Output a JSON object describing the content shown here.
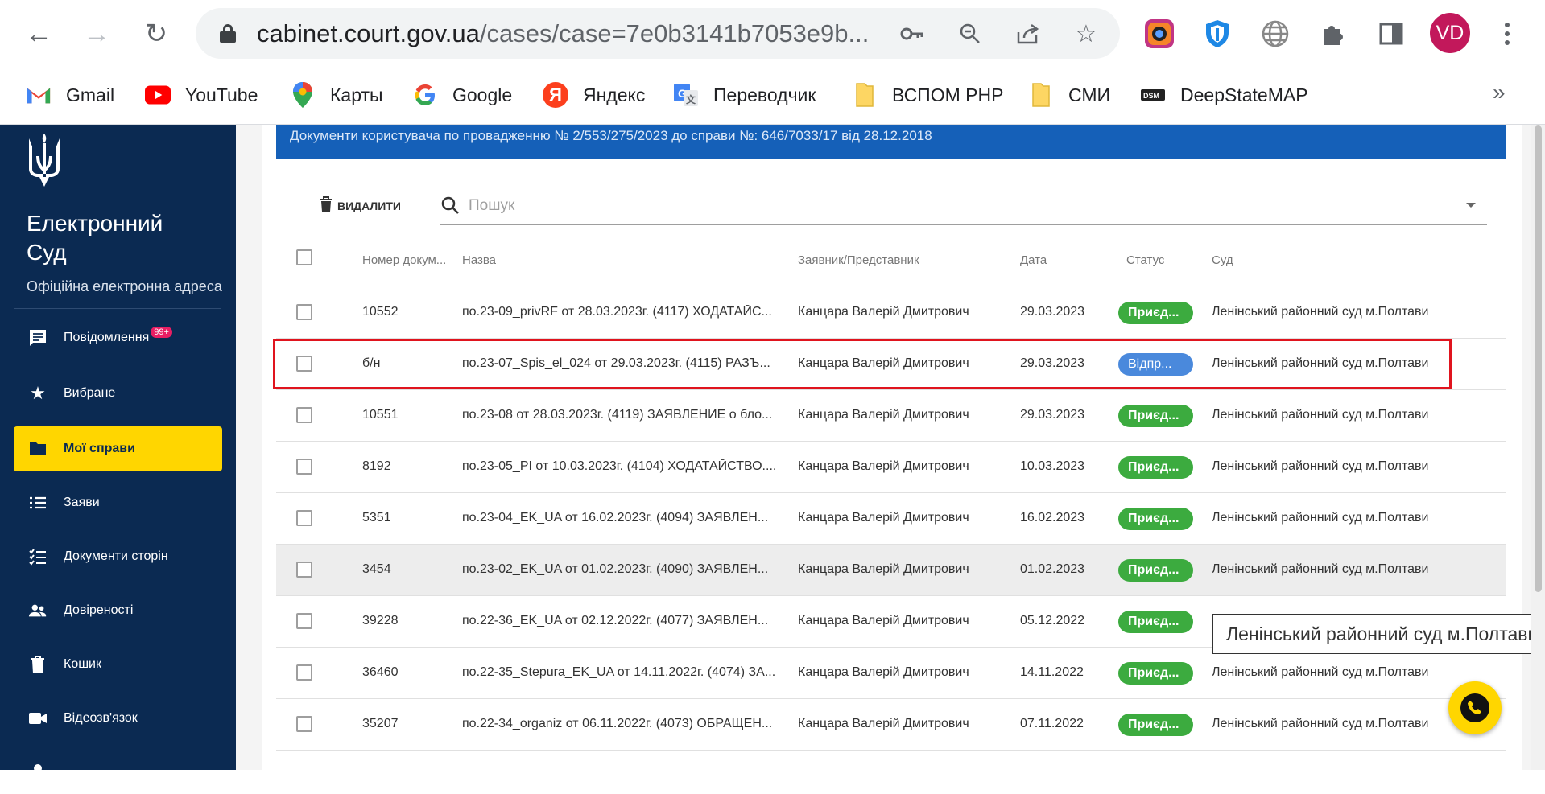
{
  "browser": {
    "url_host": "cabinet.court.gov.ua",
    "url_path": "/cases/case=7e0b3141b7053e9b...",
    "avatar_initials": "VD",
    "bookmarks": [
      {
        "label": "Gmail",
        "icon": "gmail-icon",
        "color": "#ea4335"
      },
      {
        "label": "YouTube",
        "icon": "youtube-icon",
        "color": "#ff0000"
      },
      {
        "label": "Карты",
        "icon": "maps-pin-icon",
        "color": "#34a853"
      },
      {
        "label": "Google",
        "icon": "google-g-icon",
        "color": "#4285f4"
      },
      {
        "label": "Яндекс",
        "icon": "yandex-icon",
        "color": "#fc3f1d"
      },
      {
        "label": "Переводчик",
        "icon": "translate-icon",
        "color": "#4285f4"
      },
      {
        "label": "ВСПОМ PHP",
        "icon": "folder-icon",
        "color": "#fdd663"
      },
      {
        "label": "СМИ",
        "icon": "folder-icon",
        "color": "#fdd663"
      },
      {
        "label": "DeepStateMAP",
        "icon": "deepstate-icon",
        "color": "#222222"
      }
    ]
  },
  "sidebar": {
    "brand_line1": "Електронний",
    "brand_line2": "Суд",
    "brand_sub": "Офіційна електронна адреса",
    "notifications_badge": "99+",
    "items": [
      {
        "label": "Повідомлення",
        "icon": "message-icon"
      },
      {
        "label": "Вибране",
        "icon": "star-icon"
      },
      {
        "label": "Мої справи",
        "icon": "folder-icon",
        "active": true
      },
      {
        "label": "Заяви",
        "icon": "list-icon"
      },
      {
        "label": "Документи сторін",
        "icon": "checklist-icon"
      },
      {
        "label": "Довіреності",
        "icon": "people-icon"
      },
      {
        "label": "Кошик",
        "icon": "trash-icon"
      },
      {
        "label": "Відеозв'язок",
        "icon": "video-icon"
      }
    ]
  },
  "main": {
    "title": "Документи користувача по провадженню № 2/553/275/2023 до справи №: 646/7033/17 від 28.12.2018",
    "delete_label": "ВИДАЛИТИ",
    "search_placeholder": "Пошук",
    "columns": {
      "number": "Номер докум...",
      "name": "Назва",
      "applicant": "Заявник/Представник",
      "date": "Дата",
      "status": "Статус",
      "court": "Суд"
    },
    "rows": [
      {
        "number": "10552",
        "name": "по.23-09_privRF от 28.03.2023г. (4117) ХОДАТАЙС...",
        "applicant": "Канцара Валерій Дмитрович",
        "date": "29.03.2023",
        "status": "Приєд...",
        "status_color": "#3cab3f",
        "court": "Ленінський районний суд м.Полтави"
      },
      {
        "number": "б/н",
        "name": "по.23-07_Spis_el_024 от 29.03.2023г. (4115) РАЗЪ...",
        "applicant": "Канцара Валерій Дмитрович",
        "date": "29.03.2023",
        "status": "Відпр...",
        "status_color": "#4a89dc",
        "court": "Ленінський районний суд м.Полтави"
      },
      {
        "number": "10551",
        "name": "по.23-08 от 28.03.2023г. (4119) ЗАЯВЛЕНИЕ о бло...",
        "applicant": "Канцара Валерій Дмитрович",
        "date": "29.03.2023",
        "status": "Приєд...",
        "status_color": "#3cab3f",
        "court": "Ленінський районний суд м.Полтави"
      },
      {
        "number": "8192",
        "name": "по.23-05_PI от 10.03.2023г. (4104) ХОДАТАЙСТВО....",
        "applicant": "Канцара Валерій Дмитрович",
        "date": "10.03.2023",
        "status": "Приєд...",
        "status_color": "#3cab3f",
        "court": "Ленінський районний суд м.Полтави"
      },
      {
        "number": "5351",
        "name": "по.23-04_EK_UA от 16.02.2023г. (4094) ЗАЯВЛЕН...",
        "applicant": "Канцара Валерій Дмитрович",
        "date": "16.02.2023",
        "status": "Приєд...",
        "status_color": "#3cab3f",
        "court": "Ленінський районний суд м.Полтави"
      },
      {
        "number": "3454",
        "name": "по.23-02_EK_UA от 01.02.2023г. (4090) ЗАЯВЛЕН...",
        "applicant": "Канцара Валерій Дмитрович",
        "date": "01.02.2023",
        "status": "Приєд...",
        "status_color": "#3cab3f",
        "court": "Ленінський районний суд м.Полтави"
      },
      {
        "number": "39228",
        "name": "по.22-36_EK_UA от 02.12.2022г. (4077) ЗАЯВЛЕН...",
        "applicant": "Канцара Валерій Дмитрович",
        "date": "05.12.2022",
        "status": "Приєд...",
        "status_color": "#3cab3f",
        "court": ""
      },
      {
        "number": "36460",
        "name": "по.22-35_Stepura_EK_UA от 14.11.2022г. (4074) ЗА...",
        "applicant": "Канцара Валерій Дмитрович",
        "date": "14.11.2022",
        "status": "Приєд...",
        "status_color": "#3cab3f",
        "court": "Ленінський районний суд м.Полтави"
      },
      {
        "number": "35207",
        "name": "по.22-34_organiz от 06.11.2022г. (4073) ОБРАЩЕН...",
        "applicant": "Канцара Валерій Дмитрович",
        "date": "07.11.2022",
        "status": "Приєд...",
        "status_color": "#3cab3f",
        "court": "Ленінський районний суд м.Полтави"
      }
    ],
    "tooltip": "Ленінський районний суд м.Полтави"
  }
}
